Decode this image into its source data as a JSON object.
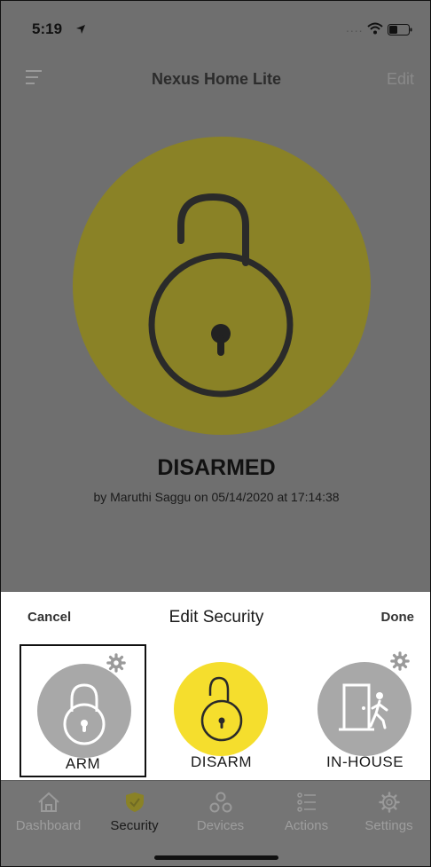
{
  "status_bar": {
    "time": "5:19",
    "location_icon": "location-arrow-icon",
    "signal": "....",
    "wifi_icon": "wifi-icon",
    "battery_icon": "battery-icon"
  },
  "nav": {
    "title": "Nexus Home Lite",
    "edit_label": "Edit",
    "menu_icon": "menu-icon"
  },
  "status": {
    "state": "DISARMED",
    "byline": "by Maruthi Saggu on 05/14/2020 at 17:14:38",
    "lock_icon": "unlocked-padlock-icon"
  },
  "sheet": {
    "cancel_label": "Cancel",
    "title": "Edit Security",
    "done_label": "Done",
    "options": [
      {
        "label": "ARM",
        "icon": "locked-padlock-icon",
        "settings_icon": "gear-icon",
        "selected": true
      },
      {
        "label": "DISARM",
        "icon": "unlocked-padlock-icon",
        "selected": false
      },
      {
        "label": "IN-HOUSE",
        "icon": "person-door-icon",
        "settings_icon": "gear-icon",
        "selected": false
      }
    ]
  },
  "tabs": [
    {
      "label": "Dashboard",
      "icon": "home-icon",
      "active": false
    },
    {
      "label": "Security",
      "icon": "shield-icon",
      "active": true
    },
    {
      "label": "Devices",
      "icon": "devices-icon",
      "active": false
    },
    {
      "label": "Actions",
      "icon": "list-icon",
      "active": false
    },
    {
      "label": "Settings",
      "icon": "gear-icon",
      "active": false
    }
  ],
  "colors": {
    "accent_yellow": "#f5de2d",
    "dim_yellow": "#8a8226",
    "overlay_gray": "#6f6f6f",
    "option_gray": "#a8a8a8"
  }
}
